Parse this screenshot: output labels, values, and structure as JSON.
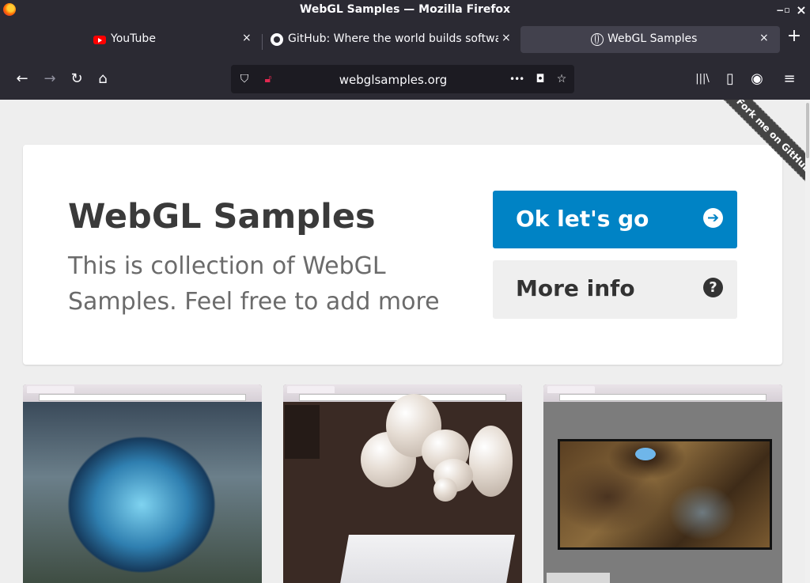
{
  "window": {
    "title": "WebGL Samples — Mozilla Firefox",
    "controls": {
      "minimize": "−",
      "maximize": "▫",
      "close": "×"
    }
  },
  "tabs": [
    {
      "label": "YouTube",
      "icon": "youtube-icon",
      "active": false,
      "close": "×"
    },
    {
      "label": "GitHub: Where the world builds softwa",
      "icon": "github-icon",
      "active": false,
      "close": "×"
    },
    {
      "label": "WebGL Samples",
      "icon": "globe-icon",
      "active": true,
      "close": "×"
    }
  ],
  "new_tab": "+",
  "nav": {
    "back": "←",
    "forward": "→",
    "reload": "↻",
    "home": "⌂",
    "url": "webglsamples.org",
    "page_actions": "•••",
    "library": "|||\\",
    "sidebar": "▯",
    "account": "◉",
    "menu": "≡"
  },
  "hero": {
    "title": "WebGL Samples",
    "lead": "This is collection of WebGL Samples. Feel free to add more",
    "primary_button": {
      "label": "Ok let's go",
      "icon": "arrow-right-circle-icon",
      "glyph": "➔"
    },
    "secondary_button": {
      "label": "More info",
      "icon": "question-circle-icon",
      "glyph": "?"
    }
  },
  "ribbon": {
    "label": "Fork me on GitHub"
  },
  "colors": {
    "primary": "#0083c5",
    "chrome_bg": "#2b2a33",
    "page_bg": "#eeeeee"
  }
}
